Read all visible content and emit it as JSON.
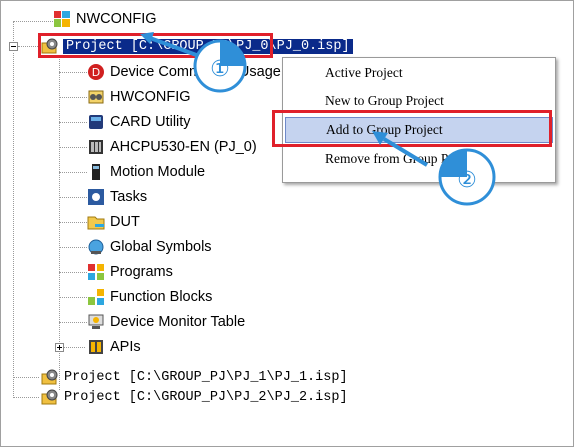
{
  "tree": {
    "nwconfig": "NWCONFIG",
    "project0": "Project [C:\\GROUP_PJ\\PJ_0\\PJ_0.isp]",
    "children": [
      "Device Comment & Usage",
      "HWCONFIG",
      "CARD Utility",
      "AHCPU530-EN  (PJ_0)",
      "Motion Module",
      "Tasks",
      "DUT",
      "Global Symbols",
      "Programs",
      "Function Blocks",
      "Device Monitor Table",
      "APIs"
    ],
    "project1": "Project [C:\\GROUP_PJ\\PJ_1\\PJ_1.isp]",
    "project2": "Project [C:\\GROUP_PJ\\PJ_2\\PJ_2.isp]"
  },
  "context_menu": {
    "items": [
      "Active Project",
      "New to Group Project",
      "Add to Group Project",
      "Remove from Group Project"
    ],
    "highlighted_index": 2
  },
  "callouts": {
    "step1": "①",
    "step2": "②"
  },
  "colors": {
    "highlight_box": "#e0202a",
    "selection": "#0a2a8a",
    "callout_fill": "#2f8fd8",
    "menu_highlight": "#c5d3ef"
  }
}
